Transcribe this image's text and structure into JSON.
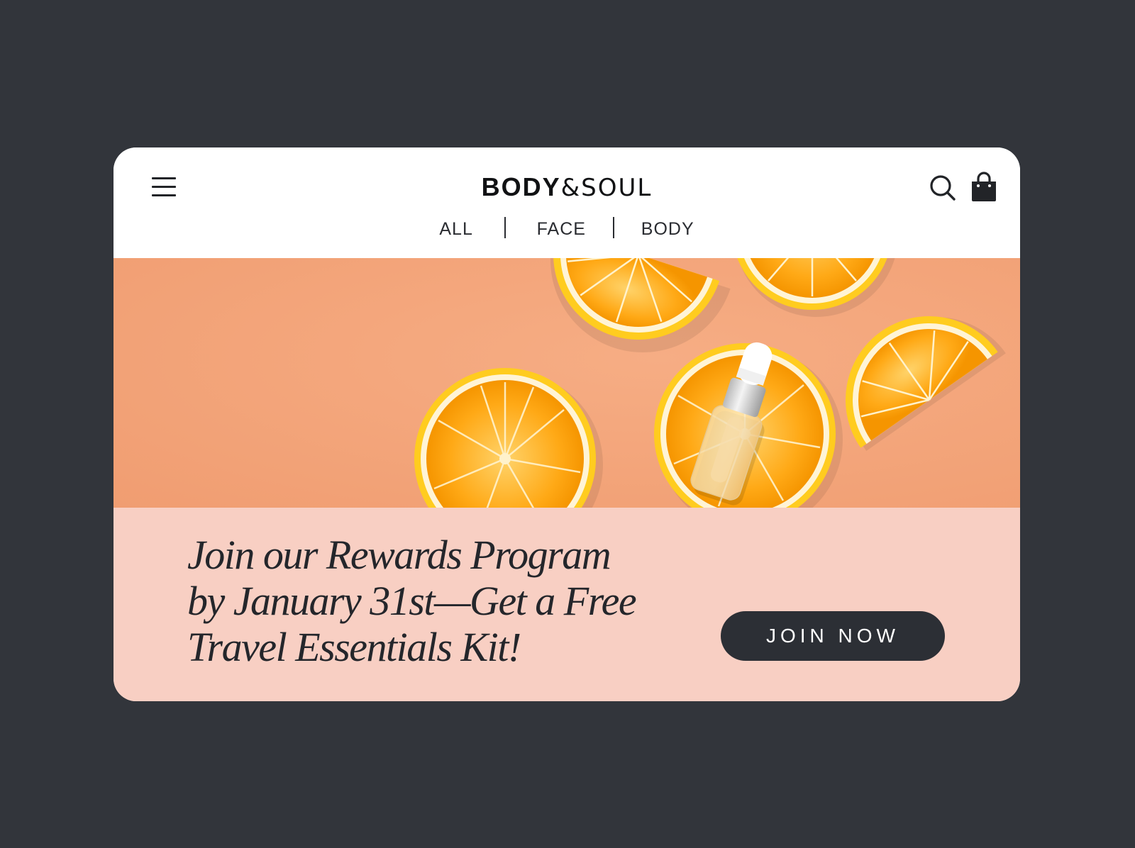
{
  "header": {
    "logo_bold": "BODY",
    "logo_light": "&SOUL",
    "nav": [
      {
        "label": "ALL"
      },
      {
        "label": "FACE"
      },
      {
        "label": "BODY"
      }
    ],
    "icons": [
      "menu-icon",
      "search-icon",
      "shopping-bag-icon"
    ]
  },
  "hero": {
    "image": "orange slices with serum dropper bottle on peach background"
  },
  "promo": {
    "line1": "Join our Rewards Program",
    "line2": "by January 31st—Get a Free",
    "line3": "Travel Essentials Kit!",
    "button_label": "JOIN NOW"
  },
  "colors": {
    "background": "#32353b",
    "card": "#ffffff",
    "hero_bg": "#f3a57b",
    "promo_bg": "#f8cfc3",
    "button_bg": "#2c2f35",
    "text_dark": "#24262b"
  }
}
